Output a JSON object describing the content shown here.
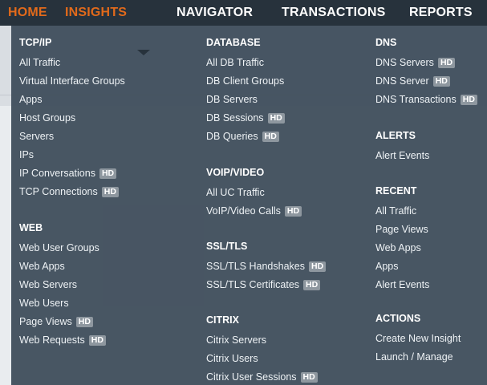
{
  "nav": {
    "tabs": [
      {
        "label": "HOME",
        "active": true
      },
      {
        "label": "INSIGHTS",
        "active": true
      },
      {
        "label": "NAVIGATOR",
        "active": false
      },
      {
        "label": "TRANSACTIONS",
        "active": false
      },
      {
        "label": "REPORTS",
        "active": false
      }
    ]
  },
  "colors": {
    "accent": "#e26a1b",
    "nav_bg": "#27323c",
    "menu_bg": "#3e4c5a",
    "hd_badge": "#8e979f"
  },
  "hd_label": "HD",
  "menu": {
    "tcpip": {
      "title": "TCP/IP",
      "items": [
        {
          "label": "All Traffic",
          "hd": false
        },
        {
          "label": "Virtual Interface Groups",
          "hd": false
        },
        {
          "label": "Apps",
          "hd": false
        },
        {
          "label": "Host Groups",
          "hd": false
        },
        {
          "label": "Servers",
          "hd": false
        },
        {
          "label": "IPs",
          "hd": false
        },
        {
          "label": "IP Conversations",
          "hd": true
        },
        {
          "label": "TCP Connections",
          "hd": true
        }
      ]
    },
    "web": {
      "title": "WEB",
      "items": [
        {
          "label": "Web User Groups",
          "hd": false
        },
        {
          "label": "Web Apps",
          "hd": false
        },
        {
          "label": "Web Servers",
          "hd": false
        },
        {
          "label": "Web Users",
          "hd": false
        },
        {
          "label": "Page Views",
          "hd": true
        },
        {
          "label": "Web Requests",
          "hd": true
        }
      ]
    },
    "database": {
      "title": "DATABASE",
      "items": [
        {
          "label": "All DB Traffic",
          "hd": false
        },
        {
          "label": "DB Client Groups",
          "hd": false
        },
        {
          "label": "DB Servers",
          "hd": false
        },
        {
          "label": "DB Sessions",
          "hd": true
        },
        {
          "label": "DB Queries",
          "hd": true
        }
      ]
    },
    "voip": {
      "title": "VOIP/VIDEO",
      "items": [
        {
          "label": "All UC Traffic",
          "hd": false
        },
        {
          "label": "VoIP/Video Calls",
          "hd": true
        }
      ]
    },
    "ssl": {
      "title": "SSL/TLS",
      "items": [
        {
          "label": "SSL/TLS Handshakes",
          "hd": true
        },
        {
          "label": "SSL/TLS Certificates",
          "hd": true
        }
      ]
    },
    "citrix": {
      "title": "CITRIX",
      "items": [
        {
          "label": "Citrix Servers",
          "hd": false
        },
        {
          "label": "Citrix Users",
          "hd": false
        },
        {
          "label": "Citrix User Sessions",
          "hd": true
        }
      ]
    },
    "dns": {
      "title": "DNS",
      "items": [
        {
          "label": "DNS Servers",
          "hd": true
        },
        {
          "label": "DNS Server",
          "hd": true
        },
        {
          "label": "DNS Transactions",
          "hd": true
        }
      ]
    },
    "alerts": {
      "title": "ALERTS",
      "items": [
        {
          "label": "Alert Events",
          "hd": false
        }
      ]
    },
    "recent": {
      "title": "RECENT",
      "items": [
        {
          "label": "All Traffic",
          "hd": false
        },
        {
          "label": "Page Views",
          "hd": false
        },
        {
          "label": "Web Apps",
          "hd": false
        },
        {
          "label": "Apps",
          "hd": false
        },
        {
          "label": "Alert Events",
          "hd": false
        }
      ]
    },
    "actions": {
      "title": "ACTIONS",
      "items": [
        {
          "label": "Create New Insight",
          "hd": false
        },
        {
          "label": "Launch / Manage",
          "hd": false
        }
      ]
    }
  }
}
